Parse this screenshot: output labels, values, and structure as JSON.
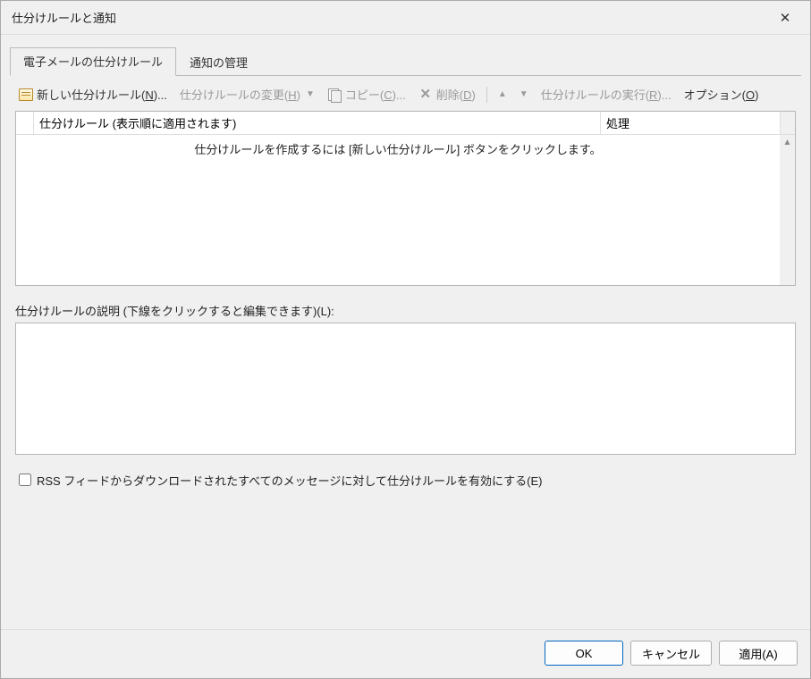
{
  "titlebar": {
    "title": "仕分けルールと通知"
  },
  "tabs": {
    "email": "電子メールの仕分けルール",
    "alerts": "通知の管理"
  },
  "toolbar": {
    "new_pre": "新しい仕分けルール(",
    "new_u": "N",
    "new_post": ")...",
    "change_pre": "仕分けルールの変更(",
    "change_u": "H",
    "change_post": ")",
    "copy_pre": "コピー(",
    "copy_u": "C",
    "copy_post": ")...",
    "delete_pre": "削除(",
    "delete_u": "D",
    "delete_post": ")",
    "run_pre": "仕分けルールの実行(",
    "run_u": "R",
    "run_post": ")...",
    "options_pre": "オプション(",
    "options_u": "O",
    "options_post": ")"
  },
  "list": {
    "header_rule": "仕分けルール (表示順に適用されます)",
    "header_action": "処理",
    "empty_msg": "仕分けルールを作成するには [新しい仕分けルール] ボタンをクリックします。"
  },
  "description": {
    "label": "仕分けルールの説明 (下線をクリックすると編集できます)(L):"
  },
  "checkbox": {
    "label": "RSS フィードからダウンロードされたすべてのメッセージに対して仕分けルールを有効にする(E)"
  },
  "footer": {
    "ok": "OK",
    "cancel": "キャンセル",
    "apply": "適用(A)"
  }
}
